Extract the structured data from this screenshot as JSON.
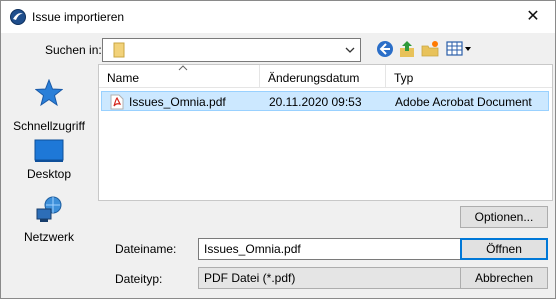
{
  "window": {
    "title": "Issue importieren",
    "close_glyph": "✕"
  },
  "lookin": {
    "label": "Suchen in:",
    "value": ""
  },
  "places": [
    {
      "label": "Schnellzugriff",
      "icon": "star-icon"
    },
    {
      "label": "Desktop",
      "icon": "desktop-icon"
    },
    {
      "label": "Netzwerk",
      "icon": "network-icon"
    }
  ],
  "list": {
    "columns": [
      "Name",
      "Änderungsdatum",
      "Typ"
    ],
    "rows": [
      {
        "name": "Issues_Omnia.pdf",
        "date": "20.11.2020 09:53",
        "type": "Adobe Acrobat Document",
        "icon": "pdf-icon",
        "selected": true
      }
    ]
  },
  "filename": {
    "label": "Dateiname:",
    "value": "Issues_Omnia.pdf"
  },
  "filetype": {
    "label": "Dateityp:",
    "value": "PDF Datei (*.pdf)"
  },
  "buttons": {
    "options": "Optionen...",
    "open": "Öffnen",
    "cancel": "Abbrechen"
  },
  "colors": {
    "accent": "#0078d7",
    "selection": "#cce8ff",
    "highlight_bg": "#ffffff"
  }
}
